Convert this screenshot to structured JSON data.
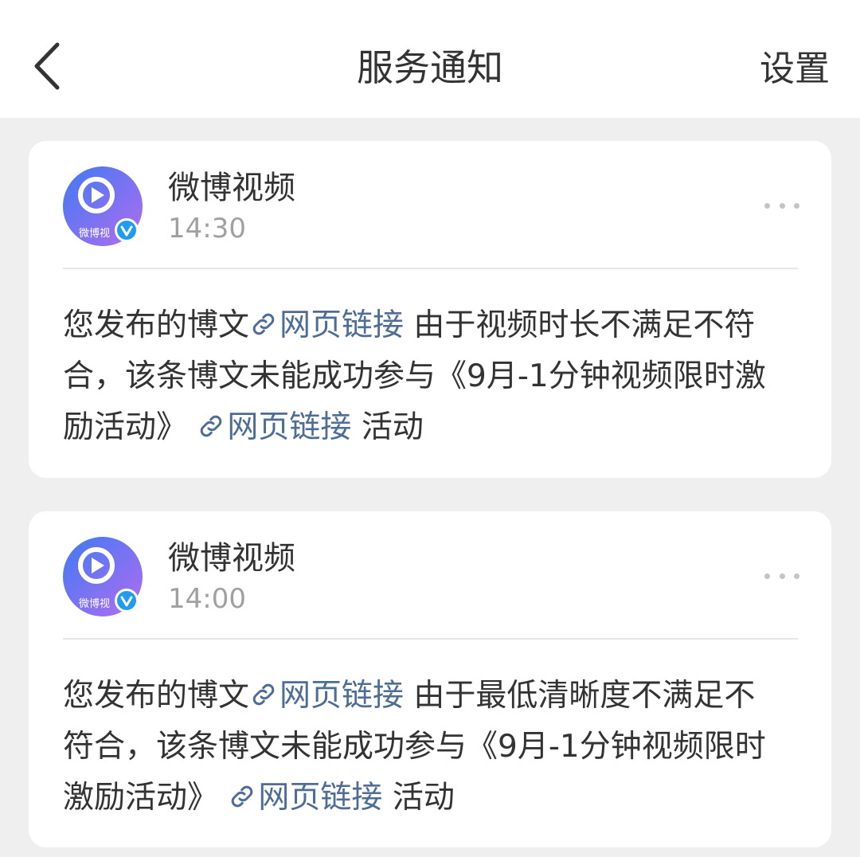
{
  "header": {
    "title": "服务通知",
    "settings_label": "设置"
  },
  "colors": {
    "link": "#4e6d96",
    "verified_badge": "#1e9df0",
    "avatar_gradient": [
      "#3f7af2",
      "#a36df0"
    ]
  },
  "notifications": [
    {
      "sender": "微博视频",
      "avatar_text": "微博视",
      "time": "14:30",
      "text_before": "您发布的博文",
      "link1": "网页链接",
      "text_middle": " 由于视频时长不满足不符合，该条博文未能成功参与《9月-1分钟视频限时激励活动》",
      "link2": "网页链接",
      "text_after": " 活动"
    },
    {
      "sender": "微博视频",
      "avatar_text": "微博视",
      "time": "14:00",
      "text_before": "您发布的博文",
      "link1": "网页链接",
      "text_middle": " 由于最低清晰度不满足不符合，该条博文未能成功参与《9月-1分钟视频限时激励活动》",
      "link2": "网页链接",
      "text_after": " 活动"
    }
  ]
}
